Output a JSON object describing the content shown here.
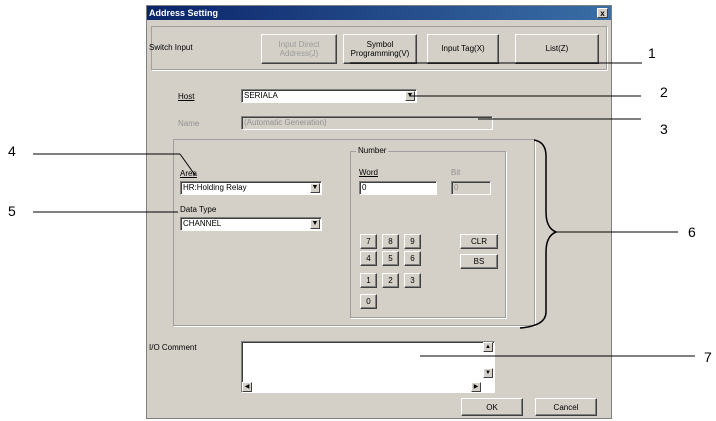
{
  "dialog": {
    "title": "Address Setting",
    "close": "x",
    "switch_input_label": "Switch Input",
    "mode_buttons": [
      {
        "label": "Input Direct Address(J)"
      },
      {
        "label": "Symbol Programming(V)"
      },
      {
        "label": "Input Tag(X)"
      },
      {
        "label": "List(Z)"
      }
    ],
    "host": {
      "label": "Host",
      "value": "SERIALA"
    },
    "name": {
      "label": "Name",
      "placeholder": "(Automatic Generation)"
    },
    "area": {
      "label": "Area",
      "value": "HR:Holding Relay"
    },
    "data_type": {
      "label": "Data Type",
      "value": "CHANNEL"
    },
    "number": {
      "group_label": "Number",
      "word_label": "Word",
      "word_value": "0",
      "bit_label": "Bit",
      "bit_value": "0"
    },
    "keypad": {
      "row1": [
        "7",
        "8",
        "9"
      ],
      "row2": [
        "4",
        "5",
        "6"
      ],
      "row3": [
        "1",
        "2",
        "3"
      ],
      "row4": [
        "0"
      ],
      "clr": "CLR",
      "bs": "BS"
    },
    "io_comment": {
      "label": "I/O Comment"
    },
    "ok": "OK",
    "cancel": "Cancel"
  },
  "callouts": [
    "1",
    "2",
    "3",
    "4",
    "5",
    "6",
    "7"
  ]
}
